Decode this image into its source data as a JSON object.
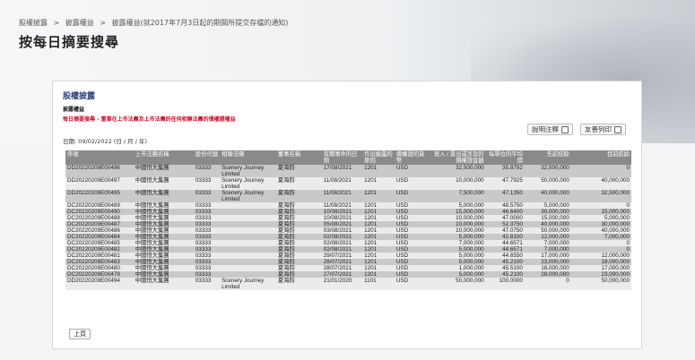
{
  "breadcrumb": {
    "items": [
      "股權披露",
      "披露權益",
      "披露權益(就2017年7月3日起的期間所提交存檔的通知)"
    ],
    "separator": ">"
  },
  "page": {
    "title": "按每日摘要搜尋"
  },
  "card": {
    "title": "股權披露",
    "section_title": "披露權益",
    "section_sub": "每日摘要搜尋 - 董事在上市法團及上市法團的任何相聯法團的債權證權益",
    "help_button": "說明注釋",
    "print_button": "友善列印",
    "date_line": "日期: 09/02/2022 (日 / 月 / 年)",
    "prev_button": "上頁"
  },
  "table": {
    "headers": [
      "序號",
      "上市法團名稱",
      "股份代號",
      "相聯法團",
      "董事名稱",
      "有關事件的日期",
      "作出披露的原因",
      "債權證的貨幣",
      "買入 / 賣出或涉及的債權證金額",
      "每單位的平均價",
      "先前結餘",
      "目前結餘"
    ],
    "rows": [
      [
        "DD20220209E00496",
        "中國恒大集團",
        "03333",
        "Scenery Journey Limited",
        "夏海鈞",
        "17/08/2021",
        "1201",
        "USD",
        "32,500,000",
        "35.8792",
        "32,500,000",
        "0"
      ],
      [
        "DD20220209E00497",
        "中國恒大集團",
        "03333",
        "Scenery Journey Limited",
        "夏海鈞",
        "11/08/2021",
        "1201",
        "USD",
        "10,000,000",
        "47.7925",
        "50,000,000",
        "40,000,000"
      ],
      [
        "DD20220209E00495",
        "中國恒大集團",
        "03333",
        "Scenery Journey Limited",
        "夏海鈞",
        "11/08/2021",
        "1201",
        "USD",
        "7,500,000",
        "47.1350",
        "40,000,000",
        "32,500,000"
      ],
      [
        "DC20220209E00489",
        "中國恒大集團",
        "03333",
        "",
        "夏海鈞",
        "11/08/2021",
        "1201",
        "USD",
        "5,000,000",
        "48.5750",
        "5,000,000",
        "0"
      ],
      [
        "DC20220209E00490",
        "中國恒大集團",
        "03333",
        "",
        "夏海鈞",
        "10/08/2021",
        "1201",
        "USD",
        "15,000,000",
        "46.6400",
        "30,000,000",
        "15,000,000"
      ],
      [
        "DC20220209E00488",
        "中國恒大集團",
        "03333",
        "",
        "夏海鈞",
        "10/08/2021",
        "1201",
        "USD",
        "10,000,000",
        "47.0000",
        "15,000,000",
        "5,000,000"
      ],
      [
        "DC20220209E00487",
        "中國恒大集團",
        "03333",
        "",
        "夏海鈞",
        "05/08/2021",
        "1201",
        "USD",
        "10,000,000",
        "52.3750",
        "40,000,000",
        "30,000,000"
      ],
      [
        "DC20220209E00486",
        "中國恒大集團",
        "03333",
        "",
        "夏海鈞",
        "03/08/2021",
        "1201",
        "USD",
        "10,000,000",
        "47.0750",
        "50,000,000",
        "40,000,000"
      ],
      [
        "DC20220209E00484",
        "中國恒大集團",
        "03333",
        "",
        "夏海鈞",
        "02/08/2021",
        "1201",
        "USD",
        "5,000,000",
        "42.8100",
        "12,000,000",
        "7,000,000"
      ],
      [
        "DC20220209E00485",
        "中國恒大集團",
        "03333",
        "",
        "夏海鈞",
        "02/08/2021",
        "1201",
        "USD",
        "7,000,000",
        "44.6571",
        "7,000,000",
        "0"
      ],
      [
        "DC20220209E00482",
        "中國恒大集團",
        "03333",
        "",
        "夏海鈞",
        "02/08/2021",
        "1201",
        "USD",
        "5,000,000",
        "44.6571",
        "7,000,000",
        "0"
      ],
      [
        "DC20220209E00481",
        "中國恒大集團",
        "03333",
        "",
        "夏海鈞",
        "29/07/2021",
        "1201",
        "USD",
        "5,000,000",
        "44.6550",
        "17,000,000",
        "12,000,000"
      ],
      [
        "DC20220209E00483",
        "中國恒大集團",
        "03333",
        "",
        "夏海鈞",
        "28/07/2021",
        "1201",
        "USD",
        "5,000,000",
        "45.2100",
        "23,000,000",
        "18,000,000"
      ],
      [
        "DC20220209E00480",
        "中國恒大集團",
        "03333",
        "",
        "夏海鈞",
        "28/07/2021",
        "1201",
        "USD",
        "1,000,000",
        "45.5100",
        "18,000,000",
        "17,000,000"
      ],
      [
        "DC20220209E00479",
        "中國恒大集團",
        "03333",
        "",
        "夏海鈞",
        "27/07/2021",
        "1201",
        "USD",
        "5,000,000",
        "45.2100",
        "28,000,000",
        "23,000,000"
      ],
      [
        "DD20220209E00494",
        "中國恒大集團",
        "03333",
        "Scenery Journey Limited",
        "夏海鈞",
        "21/01/2020",
        "1101",
        "USD",
        "50,000,000",
        "100.0000",
        "0",
        "50,000,000"
      ]
    ]
  }
}
